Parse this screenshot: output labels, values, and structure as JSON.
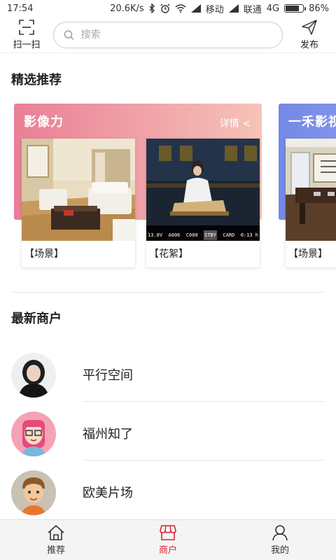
{
  "status_bar": {
    "time": "17:54",
    "network_speed": "20.6K/s",
    "carrier1": "移动",
    "carrier2": "联通",
    "network_type": "4G",
    "battery": "86%",
    "battery_level": 0.86
  },
  "header": {
    "scan_label": "扫一扫",
    "search_placeholder": "搜索",
    "publish_label": "发布"
  },
  "featured": {
    "title": "精选推荐",
    "cards": [
      {
        "title": "影像力",
        "more": "详情 <",
        "gradient": [
          "#e97f96",
          "#f6c3b8"
        ],
        "items": [
          {
            "caption": "【场景】",
            "image": "living-room-photo"
          },
          {
            "caption": "【花絮】",
            "image": "film-set-monitor-photo"
          }
        ]
      },
      {
        "title": "一禾影视",
        "gradient": [
          "#7489e6",
          "#a9b5f2"
        ],
        "items": [
          {
            "caption": "【场景】",
            "image": "tea-room-photo"
          }
        ]
      }
    ],
    "monitor_overlay": {
      "voltage": "13.8V",
      "clip": "A006",
      "code": "C000",
      "status": "STBY",
      "card": "CARD",
      "time": "0:13 h"
    }
  },
  "merchants": {
    "title": "最新商户",
    "items": [
      {
        "name": "平行空间",
        "avatar": "woman-photo-avatar"
      },
      {
        "name": "福州知了",
        "avatar": "cartoon-girl-avatar"
      },
      {
        "name": "欧美片场",
        "avatar": "cartoon-boy-avatar"
      }
    ]
  },
  "tabbar": {
    "active_color": "#d7262f",
    "tabs": [
      {
        "label": "推荐",
        "icon": "home-icon"
      },
      {
        "label": "商户",
        "icon": "shop-icon"
      },
      {
        "label": "我的",
        "icon": "user-icon"
      }
    ]
  }
}
